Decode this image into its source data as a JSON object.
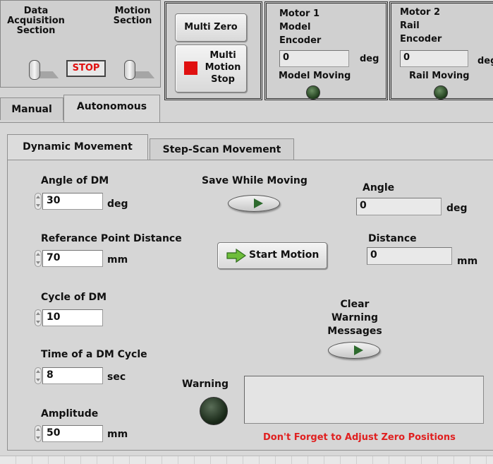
{
  "top": {
    "daq_label": "Data Acquisition Section",
    "motion_label": "Motion Section",
    "stop_label": "STOP",
    "multi_zero_label": "Multi Zero",
    "multi_motion_stop_label": "Multi Motion Stop",
    "motor1": {
      "title": "Motor 1 Model Encoder",
      "value": "0",
      "unit": "deg",
      "moving_label": "Model Moving"
    },
    "motor2": {
      "title": "Motor 2 Rail Encoder",
      "value": "0",
      "unit": "deg",
      "moving_label": "Rail Moving"
    }
  },
  "main_tabs": [
    "Manual",
    "Autonomous"
  ],
  "sub_tabs": [
    "Dynamic Movement",
    "Step-Scan Movement"
  ],
  "dm": {
    "angle_label": "Angle of DM",
    "angle_value": "30",
    "angle_unit": "deg",
    "ref_label": "Referance Point Distance",
    "ref_value": "70",
    "ref_unit": "mm",
    "cycle_label": "Cycle of DM",
    "cycle_value": "10",
    "time_label": "Time of a DM Cycle",
    "time_value": "8",
    "time_unit": "sec",
    "amp_label": "Amplitude",
    "amp_value": "50",
    "amp_unit": "mm",
    "save_label": "Save While Moving",
    "start_label": "Start Motion",
    "angle_out_label": "Angle",
    "angle_out_value": "0",
    "angle_out_unit": "deg",
    "dist_out_label": "Distance",
    "dist_out_value": "0",
    "dist_out_unit": "mm",
    "clear_label": "Clear Warning Messages",
    "warning_label": "Warning",
    "warning_text": "Don't Forget to Adjust Zero Positions"
  },
  "colors": {
    "stop_red": "#e01010",
    "warning_red": "#e02020",
    "led_green": "#2f5a2a"
  }
}
